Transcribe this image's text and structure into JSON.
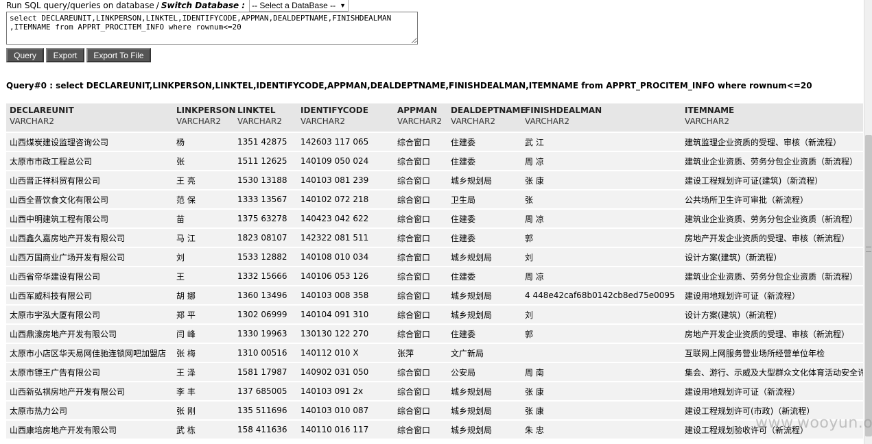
{
  "topbar": {
    "run_label": "Run SQL query/queries on database",
    "switch_label": "Switch Database :",
    "db_select_value": "-- Select a DataBase --"
  },
  "query_text": "select DECLAREUNIT,LINKPERSON,LINKTEL,IDENTIFYCODE,APPMAN,DEALDEPTNAME,FINISHDEALMAN\n,ITEMNAME from APPRT_PROCITEM_INFO where rownum<=20",
  "buttons": {
    "query": "Query",
    "export": "Export",
    "export_file": "Export To File"
  },
  "query_label": "Query#0 : select DECLAREUNIT,LINKPERSON,LINKTEL,IDENTIFYCODE,APPMAN,DEALDEPTNAME,FINISHDEALMAN,ITEMNAME from APPRT_PROCITEM_INFO where rownum<=20",
  "columns": [
    {
      "name": "DECLAREUNIT",
      "type": "VARCHAR2"
    },
    {
      "name": "LINKPERSON",
      "type": "VARCHAR2"
    },
    {
      "name": "LINKTEL",
      "type": "VARCHAR2"
    },
    {
      "name": "IDENTIFYCODE",
      "type": "VARCHAR2"
    },
    {
      "name": "APPMAN",
      "type": "VARCHAR2"
    },
    {
      "name": "DEALDEPTNAME",
      "type": "VARCHAR2"
    },
    {
      "name": "FINISHDEALMAN",
      "type": "VARCHAR2"
    },
    {
      "name": "ITEMNAME",
      "type": "VARCHAR2"
    }
  ],
  "rows": [
    [
      "山西煤炭建设监理咨询公司",
      "杨",
      "1351 42875",
      "142603 117 065",
      "综合窗口",
      "住建委",
      "武 江",
      "建筑监理企业资质的受理、审核（新流程）"
    ],
    [
      "太原市市政工程总公司",
      "张",
      "1511 12625",
      "140109 050 024",
      "综合窗口",
      "住建委",
      "周 凉",
      "建筑业企业资质、劳务分包企业资质（新流程）"
    ],
    [
      "山西晋正祥科贸有限公司",
      "王 亮",
      "1530 13188",
      "140103 081 239",
      "综合窗口",
      "城乡规划局",
      "张 康",
      "建设工程规划许可证(建筑)（新流程）"
    ],
    [
      "山西全晋饮食文化有限公司",
      "范 保",
      "1333 13567",
      "140102 072 218",
      "综合窗口",
      "卫生局",
      "张",
      "公共场所卫生许可审批（新流程）"
    ],
    [
      "山西中明建筑工程有限公司",
      "苗",
      "1375 63278",
      "140423 042 622",
      "综合窗口",
      "住建委",
      "周 凉",
      "建筑业企业资质、劳务分包企业资质（新流程）"
    ],
    [
      "山西鑫久嘉房地产开发有限公司",
      "马 江",
      "1823 08107",
      "142322 081 511",
      "综合窗口",
      "住建委",
      "郭",
      "房地产开发企业资质的受理、审核（新流程）"
    ],
    [
      "山西万国商业广场开发有限公司",
      "刘",
      "1533 12882",
      "140108 010 034",
      "综合窗口",
      "城乡规划局",
      "刘",
      "设计方案(建筑)（新流程）"
    ],
    [
      "山西省帝华建设有限公司",
      "王",
      "1332 15666",
      "140106 053 126",
      "综合窗口",
      "住建委",
      "周 凉",
      "建筑业企业资质、劳务分包企业资质（新流程）"
    ],
    [
      "山西军威科技有限公司",
      "胡 娜",
      "1360 13496",
      "140103 008 358",
      "综合窗口",
      "城乡规划局",
      "4 448e42caf68b0142cb8ed75e0095",
      "建设用地规划许可证（新流程）"
    ],
    [
      "太原市宇泓大厦有限公司",
      "郑 平",
      "1302 06999",
      "140104 091 310",
      "综合窗口",
      "城乡规划局",
      "刘",
      "设计方案(建筑)（新流程）"
    ],
    [
      "山西鼎濠房地产开发有限公司",
      "闫 峰",
      "1330 19963",
      "130130 122 270",
      "综合窗口",
      "住建委",
      "郭",
      "房地产开发企业资质的受理、审核（新流程）"
    ],
    [
      "太原市小店区华天易网佳驰连锁网吧加盟店",
      "张 梅",
      "1310 00516",
      "140112 010 X",
      "张萍",
      "文广新局",
      "",
      "互联网上网服务营业场所经营单位年检"
    ],
    [
      "太原市镖王广告有限公司",
      "王 泽",
      "1581 17987",
      "140902 031 050",
      "综合窗口",
      "公安局",
      "周 南",
      "集会、游行、示威及大型群众文化体育活动安全许"
    ],
    [
      "山西新弘祺房地产开发有限公司",
      "李 丰",
      "137 685005",
      "140103 091 2x",
      "综合窗口",
      "城乡规划局",
      "张 康",
      "建设用地规划许可证（新流程）"
    ],
    [
      "太原市热力公司",
      "张 刚",
      "135 511696",
      "140103 010 087",
      "综合窗口",
      "城乡规划局",
      "张 康",
      "建设工程规划许可(市政)（新流程）"
    ],
    [
      "山西康培房地产开发有限公司",
      "武 栋",
      "158 411636",
      "140110 016 117",
      "综合窗口",
      "城乡规划局",
      "朱 忠",
      "建设工程规划验收许可（新流程）"
    ]
  ],
  "watermark": "www.wooyun.org",
  "colors": {
    "header_bg": "#e6e6e6",
    "cell_bg": "#f2f2f2",
    "button_bg": "#555555"
  }
}
